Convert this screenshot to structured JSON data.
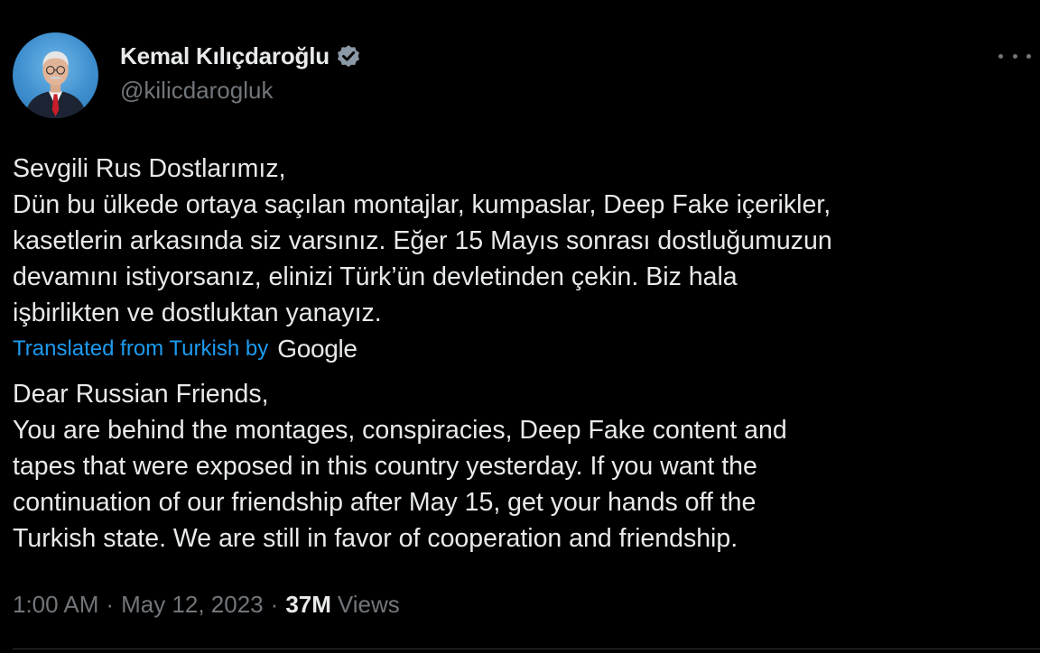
{
  "author": {
    "display_name": "Kemal Kılıçdaroğlu",
    "handle": "@kilicdarogluk",
    "verified": true
  },
  "tweet": {
    "original_lines": [
      "Sevgili Rus Dostlarımız,",
      "Dün bu ülkede ortaya saçılan montajlar, kumpaslar, Deep Fake içerikler,",
      "kasetlerin arkasında siz varsınız. Eğer 15 Mayıs sonrası dostluğumuzun",
      "devamını istiyorsanız, elinizi Türk’ün devletinden çekin. Biz hala",
      "işbirlikten ve dostluktan yanayız."
    ],
    "translation_label": "Translated from Turkish by",
    "translation_provider": "Google",
    "translated_lines": [
      "Dear Russian Friends,",
      "You are behind the montages, conspiracies, Deep Fake content and",
      "tapes that were exposed in this country yesterday. If you want the",
      "continuation of our friendship after May 15, get your hands off the",
      "Turkish state. We are still in favor of cooperation and friendship."
    ]
  },
  "meta": {
    "time": "1:00 AM",
    "separator": "·",
    "date": "May 12, 2023",
    "views_count": "37M",
    "views_label": "Views"
  },
  "icons": {
    "more": "more-horizontal-icon",
    "verified": "verified-badge-icon"
  },
  "colors": {
    "background": "#000000",
    "text": "#e7e9ea",
    "secondary": "#71767b",
    "link": "#1d9bf0"
  }
}
